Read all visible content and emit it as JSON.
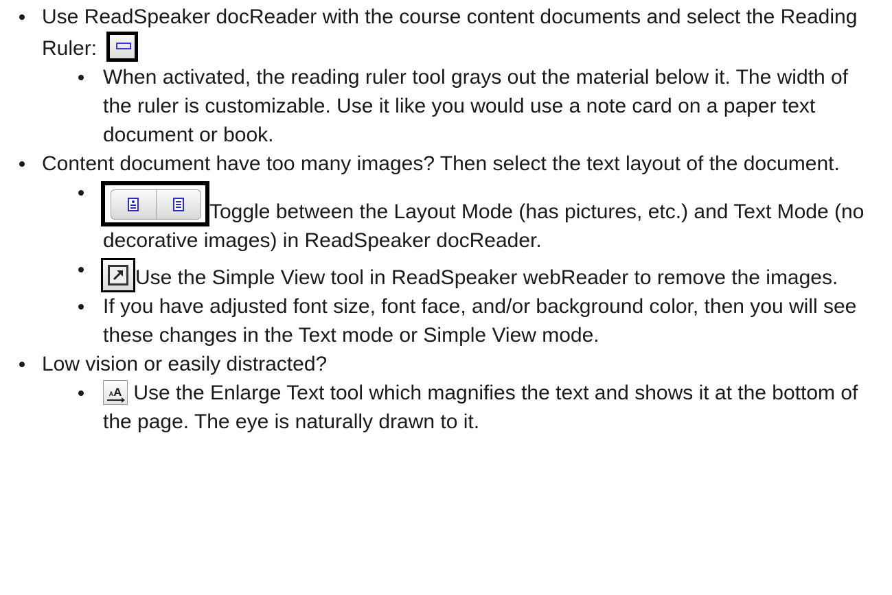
{
  "items": [
    {
      "text_before": "Use ReadSpeaker docReader with the course content documents and select the Reading Ruler:",
      "icon": "reading-ruler-icon",
      "children": [
        {
          "text": "When activated, the reading ruler tool grays out the material below it.  The width of the ruler is customizable. Use it like you would use a note card on a paper text document or book."
        }
      ]
    },
    {
      "text": "Content document have too many images? Then select the text layout of the document.",
      "children": [
        {
          "icon": "layout-text-toggle-icon",
          "text": "Toggle between the Layout Mode (has pictures, etc.) and Text Mode (no decorative images) in ReadSpeaker docReader."
        },
        {
          "icon": "simple-view-icon",
          "text": "Use the Simple View tool in ReadSpeaker webReader to remove the images."
        },
        {
          "text": "If you have adjusted font size, font face, and/or background color, then you will see these changes in the Text mode or Simple View mode."
        }
      ]
    },
    {
      "text": "Low vision or easily distracted?",
      "children": [
        {
          "icon": "enlarge-text-icon",
          "icon_label_small": "A",
          "icon_label_large": "A",
          "text": " Use the Enlarge Text tool which magnifies the text and shows it at the bottom of the page.  The eye is naturally drawn to it."
        }
      ]
    }
  ]
}
